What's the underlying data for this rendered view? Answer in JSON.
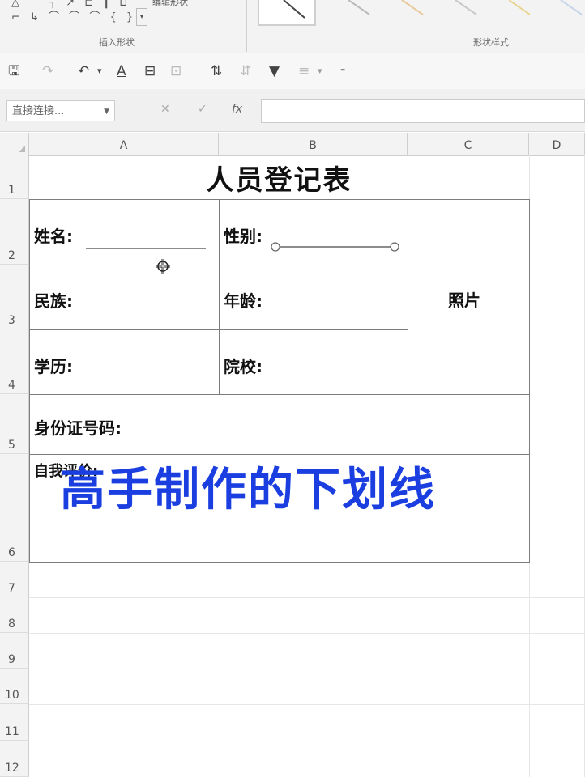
{
  "ribbon": {
    "shapes_row1": "△ ⌒ ┐ ↗ ⊏ ┃ ⊔",
    "shapes_row2": "⌐ ↳ ⌒ ⌒ ⌒ { }",
    "more_glyph": "▾",
    "edit_shape_label": "编辑形状",
    "insert_shapes_group": "插入形状",
    "shape_styles_group": "形状样式"
  },
  "qat": {
    "save": "🖫",
    "redo": "↷",
    "undo": "↶",
    "undo_dd": "▾",
    "font_color": "A",
    "merge": "⊟",
    "format": "⊡",
    "sort": "⇅",
    "sort2": "⇵",
    "filter": "▼",
    "more": "≡",
    "more_dd": "▾",
    "customize": "⁼"
  },
  "formula_bar": {
    "name_box": "直接连接...",
    "name_box_dd": "▼",
    "cancel": "✕",
    "enter": "✓",
    "fx": "fx"
  },
  "columns": [
    "A",
    "B",
    "C",
    "D"
  ],
  "rows": [
    "1",
    "2",
    "3",
    "4",
    "5",
    "6",
    "7",
    "8",
    "9",
    "10",
    "11",
    "12"
  ],
  "form": {
    "title": "人员登记表",
    "name_label": "姓名:",
    "gender_label": "性别:",
    "photo_label": "照片",
    "ethnicity_label": "民族:",
    "age_label": "年龄:",
    "education_label": "学历:",
    "school_label": "院校:",
    "id_label": "身份证号码:",
    "self_eval_label": "自我评价:"
  },
  "overlay_caption": "高手制作的下划线",
  "colors": {
    "caption": "#1a3ee0",
    "border": "#7d7d7d"
  }
}
